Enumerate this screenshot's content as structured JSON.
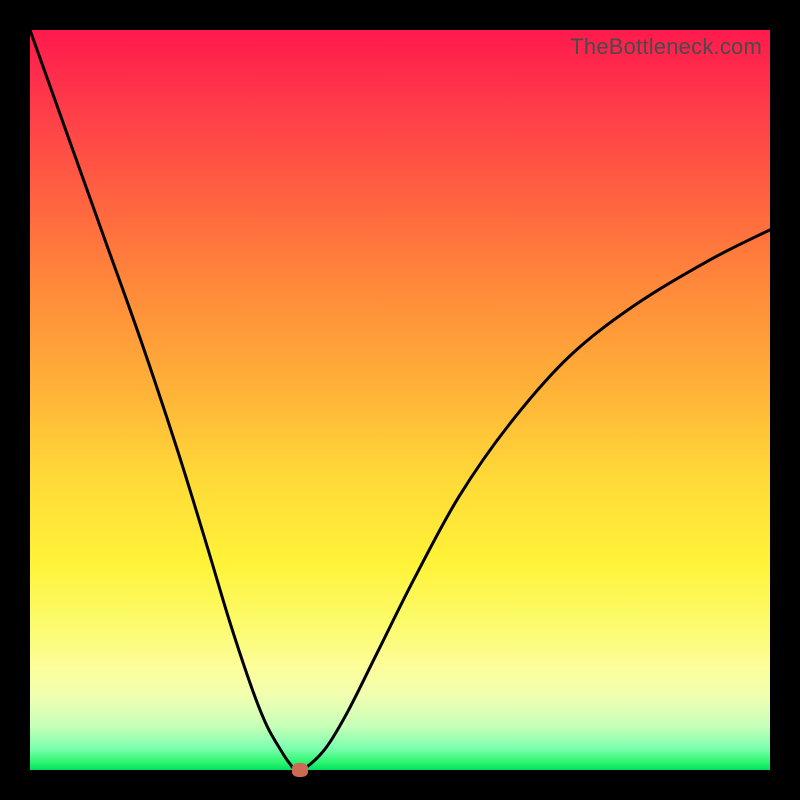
{
  "watermark": "TheBottleneck.com",
  "colors": {
    "frame": "#000000",
    "curve": "#000000",
    "marker": "#cc6a55"
  },
  "chart_data": {
    "type": "line",
    "title": "",
    "xlabel": "",
    "ylabel": "",
    "xlim": [
      0,
      100
    ],
    "ylim": [
      0,
      100
    ],
    "grid": false,
    "legend": false,
    "series": [
      {
        "name": "bottleneck-curve",
        "x": [
          0,
          5,
          10,
          15,
          20,
          24,
          27,
          30,
          32,
          34,
          35,
          36,
          37.5,
          40,
          43,
          47,
          52,
          58,
          65,
          73,
          82,
          92,
          100
        ],
        "y": [
          100,
          86,
          72,
          58,
          43,
          30,
          20,
          11,
          6,
          2.5,
          1,
          0,
          0.5,
          3,
          8,
          16,
          26,
          37,
          47,
          56,
          63,
          69,
          73
        ]
      }
    ],
    "marker": {
      "x": 36.5,
      "y": 0
    },
    "background_gradient": [
      {
        "stop": 0.0,
        "color": "#ff1a4d"
      },
      {
        "stop": 0.5,
        "color": "#ffb038"
      },
      {
        "stop": 0.75,
        "color": "#fff338"
      },
      {
        "stop": 0.95,
        "color": "#c8ffb8"
      },
      {
        "stop": 1.0,
        "color": "#00e060"
      }
    ]
  }
}
